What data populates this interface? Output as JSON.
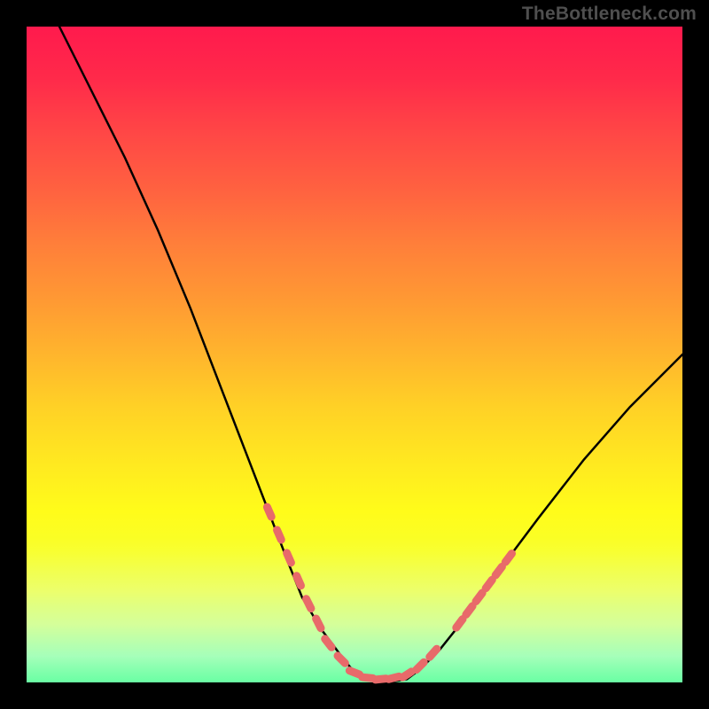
{
  "attribution": "TheBottleneck.com",
  "colors": {
    "page_bg": "#000000",
    "gradient_top": "#ff1a4d",
    "gradient_bottom": "#1dff86",
    "curve": "#000000",
    "marker": "#e86a6a"
  },
  "chart_data": {
    "type": "line",
    "title": "",
    "xlabel": "",
    "ylabel": "",
    "xlim": [
      0,
      100
    ],
    "ylim": [
      0,
      100
    ],
    "grid": false,
    "legend": false,
    "series": [
      {
        "name": "bottleneck-curve",
        "x": [
          5,
          10,
          15,
          20,
          25,
          30,
          35,
          40,
          42,
          45,
          48,
          50,
          52,
          55,
          58,
          60,
          63,
          67,
          72,
          78,
          85,
          92,
          100
        ],
        "y": [
          100,
          90,
          80,
          69,
          57,
          44,
          31,
          18,
          13,
          8,
          4,
          1.5,
          0.5,
          0,
          0.5,
          2,
          5,
          10,
          17,
          25,
          34,
          42,
          50
        ]
      }
    ],
    "markers": {
      "name": "highlighted-points",
      "color": "#e86a6a",
      "points": [
        {
          "x": 37,
          "y": 26
        },
        {
          "x": 38.5,
          "y": 22.5
        },
        {
          "x": 40,
          "y": 19
        },
        {
          "x": 41.5,
          "y": 15.5
        },
        {
          "x": 43,
          "y": 12
        },
        {
          "x": 44.5,
          "y": 9
        },
        {
          "x": 46,
          "y": 6
        },
        {
          "x": 48,
          "y": 3.5
        },
        {
          "x": 50,
          "y": 1.5
        },
        {
          "x": 52,
          "y": 0.7
        },
        {
          "x": 54,
          "y": 0.5
        },
        {
          "x": 56,
          "y": 0.7
        },
        {
          "x": 58,
          "y": 1.2
        },
        {
          "x": 60,
          "y": 2.5
        },
        {
          "x": 62,
          "y": 4.5
        },
        {
          "x": 66,
          "y": 9
        },
        {
          "x": 67.5,
          "y": 11
        },
        {
          "x": 69,
          "y": 13
        },
        {
          "x": 70.5,
          "y": 15
        },
        {
          "x": 72,
          "y": 17
        },
        {
          "x": 73.5,
          "y": 19
        }
      ]
    }
  }
}
